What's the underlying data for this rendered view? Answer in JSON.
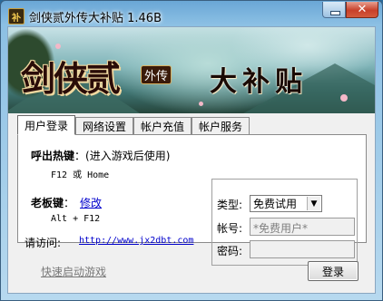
{
  "window": {
    "title": "剑侠贰外传大补贴 1.46B",
    "icon_text": "补",
    "close_glyph": "✕"
  },
  "banner": {
    "logo_text": "剑侠贰",
    "logo_badge": "外传",
    "title": "大补贴"
  },
  "tabs": [
    {
      "label": "用户登录",
      "active": true
    },
    {
      "label": "网络设置",
      "active": false
    },
    {
      "label": "帐户充值",
      "active": false
    },
    {
      "label": "帐户服务",
      "active": false
    }
  ],
  "login_panel": {
    "hotkey_label": "呼出热键",
    "hotkey_note": "：(进入游戏后使用)",
    "hotkey_value": "F12 或 Home",
    "boss_label": "老板键",
    "boss_colon": "：",
    "boss_link": "修改",
    "boss_value": "Alt + F12"
  },
  "visit": {
    "label": "请访问:",
    "url": "http://www.jx2dbt.com"
  },
  "account": {
    "type_label": "类型:",
    "type_value": "免费试用",
    "account_label": "帐号:",
    "account_value": "*免费用户*",
    "password_label": "密码:",
    "password_value": ""
  },
  "footer": {
    "quick_start": "快速启动游戏",
    "login_button": "登录"
  },
  "colors": {
    "link": "#0000cc",
    "disabled_text": "#7a7a7a",
    "close_button": "#c8402a"
  }
}
